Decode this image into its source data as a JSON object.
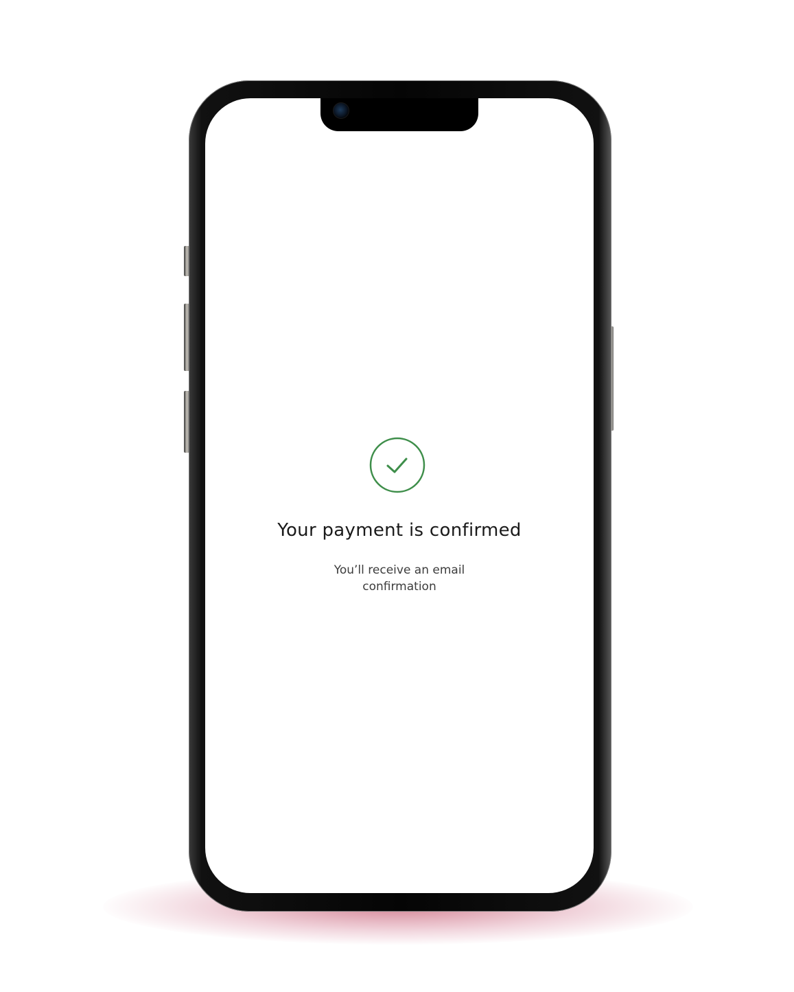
{
  "confirmation": {
    "title": "Your payment is confirmed",
    "subtitle": "You’ll receive an email confirmation"
  },
  "icons": {
    "status": "checkmark-circle-icon",
    "camera": "front-camera-icon"
  },
  "colors": {
    "success": "#3e8e4a",
    "screen_background": "#ffffff",
    "phone_frame": "#050505",
    "floor_shadow": "#b4284a"
  }
}
